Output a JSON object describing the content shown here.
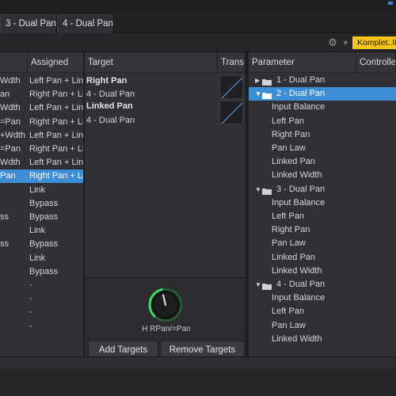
{
  "tabs": [
    "3 - Dual Pan",
    "4 - Dual Pan"
  ],
  "toolbar": {
    "gear_icon": "gear-icon",
    "preset_label": "Komplet..ID"
  },
  "left_panel": {
    "col1_header": "",
    "col2_header": "Assigned",
    "rows": [
      {
        "name": "Wdth",
        "assigned": "Left Pan + Lin"
      },
      {
        "name": "an",
        "assigned": "Right Pan + Li"
      },
      {
        "name": "Wdth",
        "assigned": "Left Pan + Lin"
      },
      {
        "name": "=Pan",
        "assigned": "Right Pan + Li"
      },
      {
        "name": "+Wdth",
        "assigned": "Left Pan + Lin"
      },
      {
        "name": "=Pan",
        "assigned": "Right Pan + Li"
      },
      {
        "name": "Wdth",
        "assigned": "Left Pan + Lin"
      },
      {
        "name": "Pan",
        "assigned": "Right Pan + Li"
      },
      {
        "name": "",
        "assigned": "Link"
      },
      {
        "name": "",
        "assigned": "Bypass"
      },
      {
        "name": "ss",
        "assigned": "Bypass"
      },
      {
        "name": "",
        "assigned": "Link"
      },
      {
        "name": "ss",
        "assigned": "Bypass"
      },
      {
        "name": "",
        "assigned": "Link"
      },
      {
        "name": "",
        "assigned": "Bypass"
      },
      {
        "name": "",
        "assigned": "-"
      },
      {
        "name": "",
        "assigned": "-"
      },
      {
        "name": "",
        "assigned": "-"
      },
      {
        "name": "",
        "assigned": "-"
      }
    ],
    "selected_index": 7
  },
  "target_panel": {
    "header": "Target",
    "trans_header": "Trans.",
    "entries": [
      {
        "title": "Right Pan",
        "sub": "4 - Dual Pan"
      },
      {
        "title": "Linked Pan",
        "sub": "4 - Dual Pan"
      }
    ],
    "knob_label": "H RPan/=Pan",
    "knob_value": 0.45,
    "add_button": "Add Targets",
    "remove_button": "Remove Targets"
  },
  "parameter_panel": {
    "header": "Parameter",
    "header2": "Controlle",
    "rows": [
      {
        "type": "group",
        "label": "1 - Dual Pan",
        "expanded": false
      },
      {
        "type": "group",
        "label": "2 - Dual Pan",
        "expanded": true,
        "selected": true
      },
      {
        "type": "item",
        "label": "Input Balance"
      },
      {
        "type": "item",
        "label": "Left Pan"
      },
      {
        "type": "item",
        "label": "Right Pan"
      },
      {
        "type": "item",
        "label": "Pan Law"
      },
      {
        "type": "item",
        "label": "Linked Pan"
      },
      {
        "type": "item",
        "label": "Linked Width"
      },
      {
        "type": "group",
        "label": "3 - Dual Pan",
        "expanded": true
      },
      {
        "type": "item",
        "label": "Input Balance"
      },
      {
        "type": "item",
        "label": "Left Pan"
      },
      {
        "type": "item",
        "label": "Right Pan"
      },
      {
        "type": "item",
        "label": "Pan Law"
      },
      {
        "type": "item",
        "label": "Linked Pan"
      },
      {
        "type": "item",
        "label": "Linked Width"
      },
      {
        "type": "group",
        "label": "4 - Dual Pan",
        "expanded": true
      },
      {
        "type": "item",
        "label": "Input Balance"
      },
      {
        "type": "item",
        "label": "Left Pan"
      },
      {
        "type": "item",
        "label": "Pan Law"
      },
      {
        "type": "item",
        "label": "Linked Width"
      }
    ]
  },
  "colors": {
    "selection": "#3d8ed6",
    "knob_ring": "#3ddc6a",
    "preset_bg": "#f5c518"
  }
}
